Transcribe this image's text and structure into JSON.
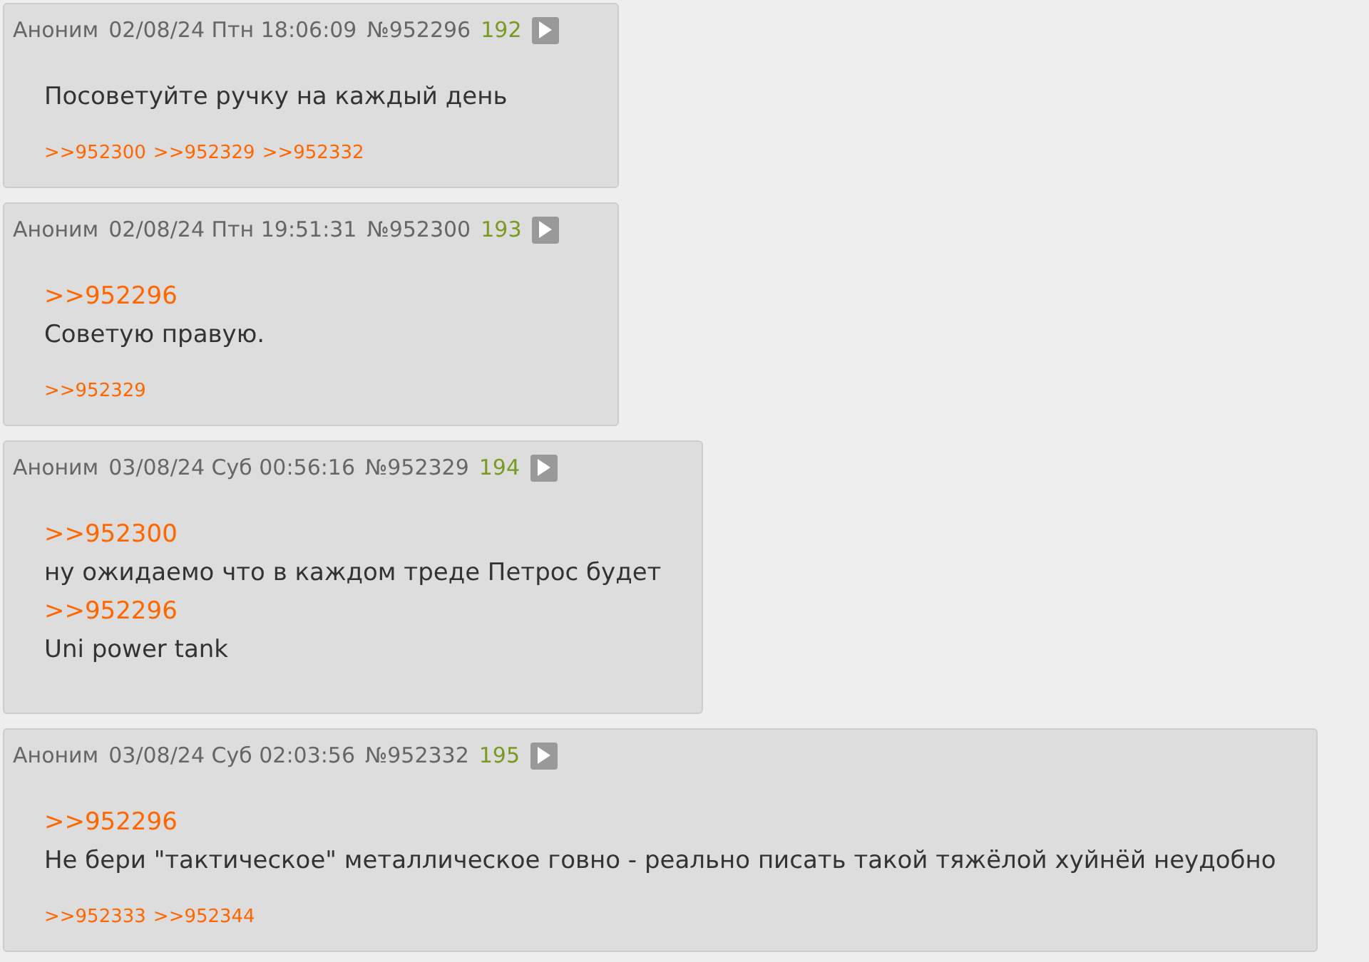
{
  "posts": [
    {
      "author": "Аноним",
      "date": "02/08/24 Птн 18:06:09",
      "number": "№952296",
      "ordinal": "192",
      "body": [
        {
          "kind": "text",
          "text": "Посоветуйте ручку на каждый день"
        }
      ],
      "replies": [
        ">>952300",
        ">>952329",
        ">>952332"
      ]
    },
    {
      "author": "Аноним",
      "date": "02/08/24 Птн 19:51:31",
      "number": "№952300",
      "ordinal": "193",
      "body": [
        {
          "kind": "link",
          "text": ">>952296"
        },
        {
          "kind": "text",
          "text": "Советую правую."
        }
      ],
      "replies": [
        ">>952329"
      ]
    },
    {
      "author": "Аноним",
      "date": "03/08/24 Суб 00:56:16",
      "number": "№952329",
      "ordinal": "194",
      "body": [
        {
          "kind": "link",
          "text": ">>952300"
        },
        {
          "kind": "text",
          "text": "ну ожидаемо что в каждом треде Петрос будет"
        },
        {
          "kind": "link",
          "text": ">>952296"
        },
        {
          "kind": "text",
          "text": "Uni power tank"
        }
      ]
    },
    {
      "author": "Аноним",
      "date": "03/08/24 Суб 02:03:56",
      "number": "№952332",
      "ordinal": "195",
      "body": [
        {
          "kind": "link",
          "text": ">>952296"
        },
        {
          "kind": "text",
          "text": "Не бери \"тактическое\" металлическое говно - реально писать такой тяжёлой хуйнёй неудобно"
        }
      ],
      "replies": [
        ">>952333",
        ">>952344"
      ]
    }
  ]
}
